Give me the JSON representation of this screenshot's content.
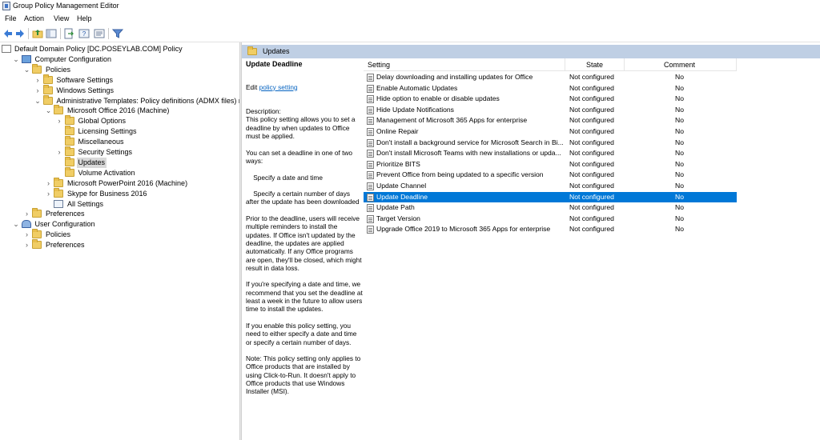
{
  "window": {
    "title": "Group Policy Management Editor"
  },
  "menu": [
    "File",
    "Action",
    "View",
    "Help"
  ],
  "toolbar_icons": [
    "back-arrow-icon",
    "forward-arrow-icon",
    "up-folder-icon",
    "show-hide-tree-icon",
    "export-list-icon",
    "help-icon",
    "properties-icon",
    "filter-icon"
  ],
  "tree": [
    {
      "label": "Default Domain Policy [DC.POSEYLAB.COM] Policy",
      "icon": "policy-icon",
      "toggle": "",
      "indent": 0
    },
    {
      "label": "Computer Configuration",
      "icon": "computer-icon",
      "toggle": "v",
      "indent": 1
    },
    {
      "label": "Policies",
      "icon": "folder-icon",
      "toggle": "v",
      "indent": 2
    },
    {
      "label": "Software Settings",
      "icon": "folder-icon",
      "toggle": ">",
      "indent": 3
    },
    {
      "label": "Windows Settings",
      "icon": "folder-icon",
      "toggle": ">",
      "indent": 3
    },
    {
      "label": "Administrative Templates: Policy definitions (ADMX files) retriev",
      "icon": "folder-icon",
      "toggle": "v",
      "indent": 3
    },
    {
      "label": "Microsoft Office 2016 (Machine)",
      "icon": "folder-icon",
      "toggle": "v",
      "indent": 4
    },
    {
      "label": "Global Options",
      "icon": "folder-icon",
      "toggle": ">",
      "indent": 5
    },
    {
      "label": "Licensing Settings",
      "icon": "folder-icon",
      "toggle": "",
      "indent": 5
    },
    {
      "label": "Miscellaneous",
      "icon": "folder-icon",
      "toggle": "",
      "indent": 5
    },
    {
      "label": "Security Settings",
      "icon": "folder-icon",
      "toggle": ">",
      "indent": 5
    },
    {
      "label": "Updates",
      "icon": "folder-icon",
      "toggle": "",
      "indent": 5,
      "selected": true
    },
    {
      "label": "Volume Activation",
      "icon": "folder-icon",
      "toggle": "",
      "indent": 5
    },
    {
      "label": "Microsoft PowerPoint 2016 (Machine)",
      "icon": "folder-icon",
      "toggle": ">",
      "indent": 4
    },
    {
      "label": "Skype for Business 2016",
      "icon": "folder-icon",
      "toggle": ">",
      "indent": 4
    },
    {
      "label": "All Settings",
      "icon": "all-settings-icon",
      "toggle": "",
      "indent": 4
    },
    {
      "label": "Preferences",
      "icon": "folder-icon",
      "toggle": ">",
      "indent": 2
    },
    {
      "label": "User Configuration",
      "icon": "user-icon",
      "toggle": "v",
      "indent": 1
    },
    {
      "label": "Policies",
      "icon": "folder-icon",
      "toggle": ">",
      "indent": 2
    },
    {
      "label": "Preferences",
      "icon": "folder-icon",
      "toggle": ">",
      "indent": 2
    }
  ],
  "breadcrumb": {
    "label": "Updates"
  },
  "description": {
    "title": "Update Deadline",
    "edit_prefix": "Edit ",
    "edit_link": "policy setting",
    "body": "Description:\nThis policy setting allows you to set a deadline by when updates to Office must be applied.\n\nYou can set a deadline in one of two ways:\n\n    Specify a date and time\n\n    Specify a certain number of days after the update has been downloaded\n\nPrior to the deadline, users will receive multiple reminders to install the updates. If Office isn't updated by the deadline, the updates are applied automatically. If any Office programs are open, they'll be closed, which might result in data loss.\n\nIf you're specifying a date and time, we recommend that you set the deadline at least a week in the future to allow users time to install the updates.\n\nIf you enable this policy setting, you need to either specify a date and time or specify a certain number of days.\n\nNote: This policy setting only applies to Office products that are installed by using Click-to-Run. It doesn't apply to Office products that use Windows Installer (MSI)."
  },
  "columns": {
    "setting": "Setting",
    "state": "State",
    "comment": "Comment"
  },
  "settings": [
    {
      "name": "Delay downloading and installing updates for Office",
      "state": "Not configured",
      "comment": "No"
    },
    {
      "name": "Enable Automatic Updates",
      "state": "Not configured",
      "comment": "No"
    },
    {
      "name": "Hide option to enable or disable updates",
      "state": "Not configured",
      "comment": "No"
    },
    {
      "name": "Hide Update Notifications",
      "state": "Not configured",
      "comment": "No"
    },
    {
      "name": "Management of Microsoft 365 Apps for enterprise",
      "state": "Not configured",
      "comment": "No"
    },
    {
      "name": "Online Repair",
      "state": "Not configured",
      "comment": "No"
    },
    {
      "name": "Don't install a background service for Microsoft Search in Bi...",
      "state": "Not configured",
      "comment": "No"
    },
    {
      "name": "Don't install Microsoft Teams with new installations or upda...",
      "state": "Not configured",
      "comment": "No"
    },
    {
      "name": "Prioritize BITS",
      "state": "Not configured",
      "comment": "No"
    },
    {
      "name": "Prevent Office from being updated to a specific version",
      "state": "Not configured",
      "comment": "No"
    },
    {
      "name": "Update Channel",
      "state": "Not configured",
      "comment": "No"
    },
    {
      "name": "Update Deadline",
      "state": "Not configured",
      "comment": "No",
      "selected": true
    },
    {
      "name": "Update Path",
      "state": "Not configured",
      "comment": "No"
    },
    {
      "name": "Target Version",
      "state": "Not configured",
      "comment": "No"
    },
    {
      "name": "Upgrade Office 2019 to Microsoft 365 Apps for enterprise",
      "state": "Not configured",
      "comment": "No"
    }
  ],
  "colors": {
    "selection": "#0078d7",
    "breadcrumb_bg": "#bfcfe4",
    "tree_selection": "#d9d9d9",
    "link": "#0563c1"
  }
}
